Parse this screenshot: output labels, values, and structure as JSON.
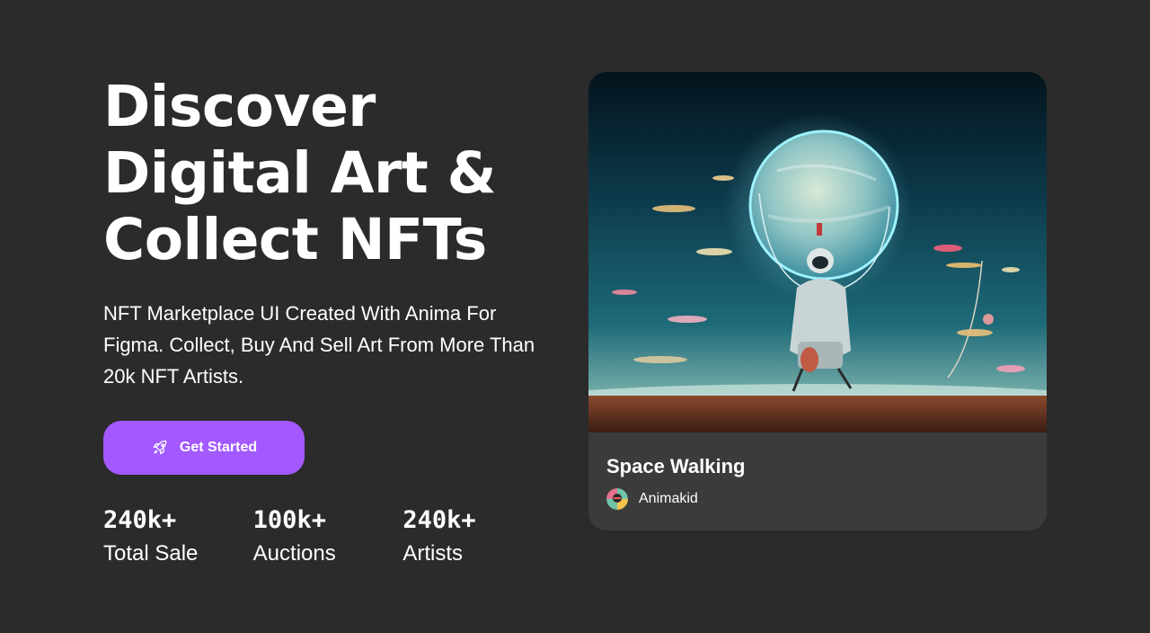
{
  "hero": {
    "headline_lines": [
      "Discover",
      "Digital Art &",
      "Collect NFTs"
    ],
    "description": "NFT Marketplace UI Created With Anima For Figma. Collect, Buy And Sell Art From More Than 20k NFT Artists.",
    "cta": {
      "label": "Get Started",
      "icon": "rocket-icon"
    },
    "stats": [
      {
        "value": "240k+",
        "label": "Total Sale"
      },
      {
        "value": "100k+",
        "label": "Auctions"
      },
      {
        "value": "240k+",
        "label": "Artists"
      }
    ]
  },
  "featured": {
    "title": "Space Walking",
    "artist": "Animakid"
  },
  "colors": {
    "background": "#2b2b2b",
    "card": "#3b3b3b",
    "accent": "#a259ff",
    "text": "#ffffff"
  }
}
